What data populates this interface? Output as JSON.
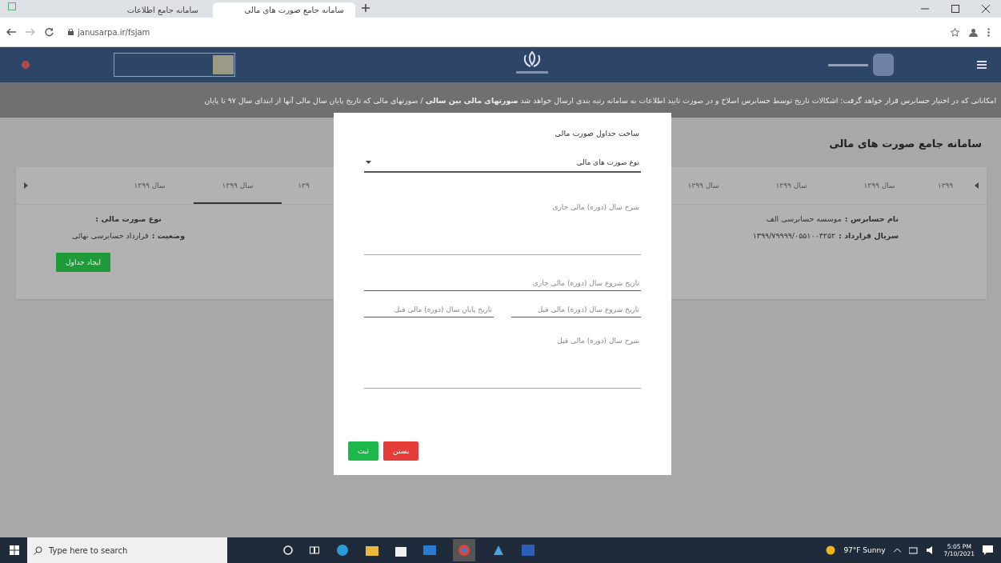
{
  "browser": {
    "tabs": [
      {
        "title": "سامانه جامع صورت های مالی",
        "selected": true
      },
      {
        "title": "سامانه جامع اطلاعات",
        "selected": false
      }
    ],
    "url": "janusarpa.ir/fsjam"
  },
  "banner": "امکاناتی که در اختیار حسابرس قرار خواهد گرفت: اشکالات تاریخ توسط حسابرس اصلاح و در صورت تایید اطلاعات به سامانه رتبه بندی ارسال خواهد شد **صورتهای مالی بین سالی** / صورتهای مالی که تاریخ پایان سال مالی آنها از ابتدای سال ۹۷ تا پایان",
  "page_title": "سامانه جامع صورت های مالی",
  "year_tabs_right": [
    {
      "label": "۱۳۹۹",
      "selected": false
    },
    {
      "label": "سال ۱۳۹۹",
      "selected": false
    },
    {
      "label": "سال ۱۳۹۹",
      "selected": false
    },
    {
      "label": "سال ۱۳۹۹",
      "selected": false
    }
  ],
  "year_tabs_left": [
    {
      "label": "۱۳۹",
      "selected": false
    },
    {
      "label": "سال ۱۳۹۹",
      "selected": true
    },
    {
      "label": "سال ۱۳۹۹",
      "selected": false
    }
  ],
  "info_right": [
    {
      "label": "نام حسابرس :",
      "value": "موسسه حسابرسی الف"
    },
    {
      "label": "سریال قرارداد :",
      "value": "۱۳۹۹/۷۹۹۹۹/۰۵۵۱۰۰۴۲۵۲"
    }
  ],
  "info_left": [
    {
      "label": "نوع صورت مالی :"
    },
    {
      "label": "وضعیت :",
      "value": "قرارداد حسابرسی نهائی"
    }
  ],
  "create_button": "ایجاد جداول",
  "modal": {
    "title": "ساخت جداول صورت مالی",
    "fields": [
      {
        "kind": "select",
        "placeholder": "نوع صورت های مالی"
      },
      {
        "kind": "textarea",
        "label": "شرح سال (دوره) مالی جاری"
      },
      {
        "kind": "date",
        "placeholder": "تاریخ شروع سال (دوره) مالی جاری"
      },
      {
        "kind": "pair",
        "placeholders": [
          "تاریخ شروع سال (دوره) مالی قبل",
          "تاریخ پایان سال (دوره) مالی قبل"
        ]
      },
      {
        "kind": "textarea",
        "label": "شرح سال (دوره) مالی قبل"
      }
    ],
    "buttons": [
      {
        "label": "بستن",
        "kind": "danger"
      },
      {
        "label": "ثبت",
        "kind": "success"
      }
    ]
  },
  "taskbar": {
    "search_placeholder": "Type here to search",
    "weather": "97°F  Sunny",
    "time": "5:05 PM",
    "date": "7/10/2021"
  }
}
